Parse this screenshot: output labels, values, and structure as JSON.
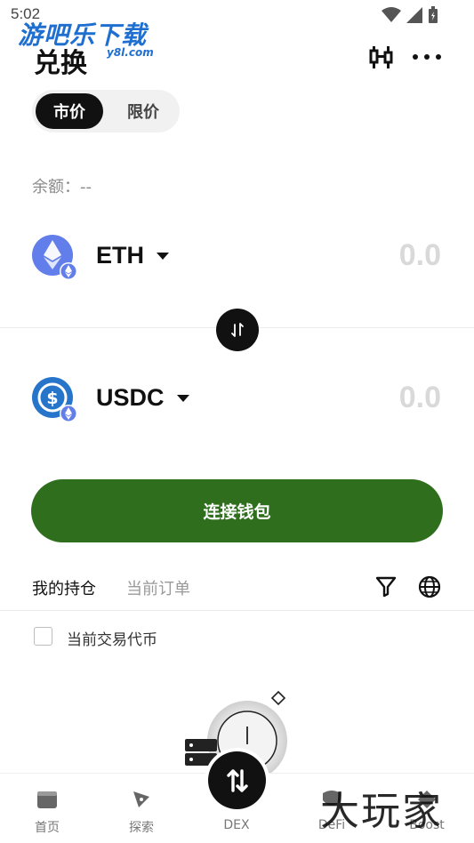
{
  "status_bar": {
    "time": "5:02"
  },
  "watermark_top": {
    "title": "游吧乐下载",
    "subtitle": "y8l.com"
  },
  "header": {
    "title": "兑换"
  },
  "order_type": {
    "active": "市价",
    "inactive": "限价"
  },
  "balance": {
    "label": "余额：--"
  },
  "from_token": {
    "symbol": "ETH",
    "amount": "0.0",
    "icon": "ethereum-icon"
  },
  "to_token": {
    "symbol": "USDC",
    "amount": "0.0",
    "icon": "usdc-icon"
  },
  "connect_button": {
    "label": "连接钱包"
  },
  "holdings_tabs": {
    "active": "我的持仓",
    "inactive": "当前订单"
  },
  "filter": {
    "checkbox_label": "当前交易代币"
  },
  "bottom_nav": {
    "items": [
      {
        "label": "首页",
        "icon": "wallet-icon"
      },
      {
        "label": "探索",
        "icon": "compass-icon"
      },
      {
        "label": "DEX",
        "icon": "swap-icon"
      },
      {
        "label": "DeFi",
        "icon": "defi-icon"
      },
      {
        "label": "Boost",
        "icon": "boost-icon"
      }
    ]
  },
  "watermark_bottom": {
    "text": "大玩家"
  },
  "colors": {
    "accent_green": "#2e6e1d",
    "eth_blue": "#627eea",
    "usdc_blue": "#2775ca"
  }
}
